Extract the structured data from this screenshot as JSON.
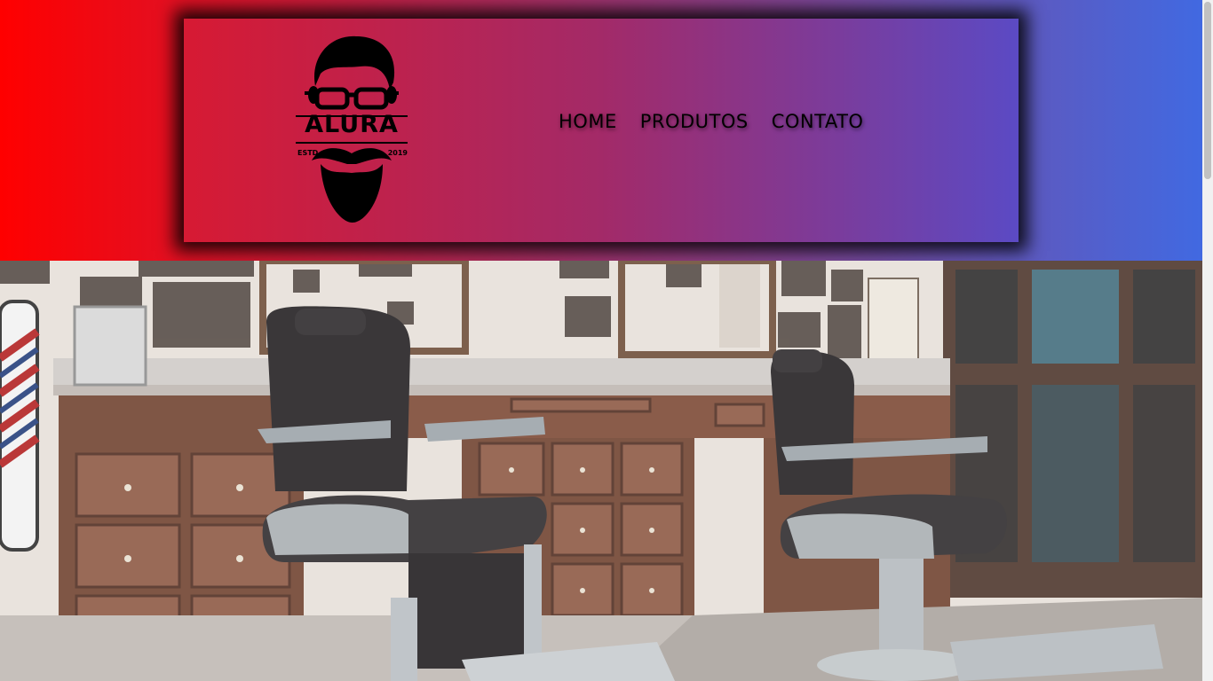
{
  "logo": {
    "wordmark": "ALURA",
    "estd_label": "ESTD",
    "year": "2019",
    "icon": "bearded-man-logo"
  },
  "nav": {
    "items": [
      {
        "label": "HOME"
      },
      {
        "label": "PRODUTOS"
      },
      {
        "label": "CONTATO"
      }
    ]
  },
  "hero": {
    "image": "barbershop-interior-photo"
  },
  "colors": {
    "header_gradient_start": "#ff0000",
    "header_gradient_end": "#4169e1",
    "panel_gradient_start": "#d71a33",
    "panel_gradient_end": "#5b4ac4",
    "nav_text": "#000000"
  }
}
